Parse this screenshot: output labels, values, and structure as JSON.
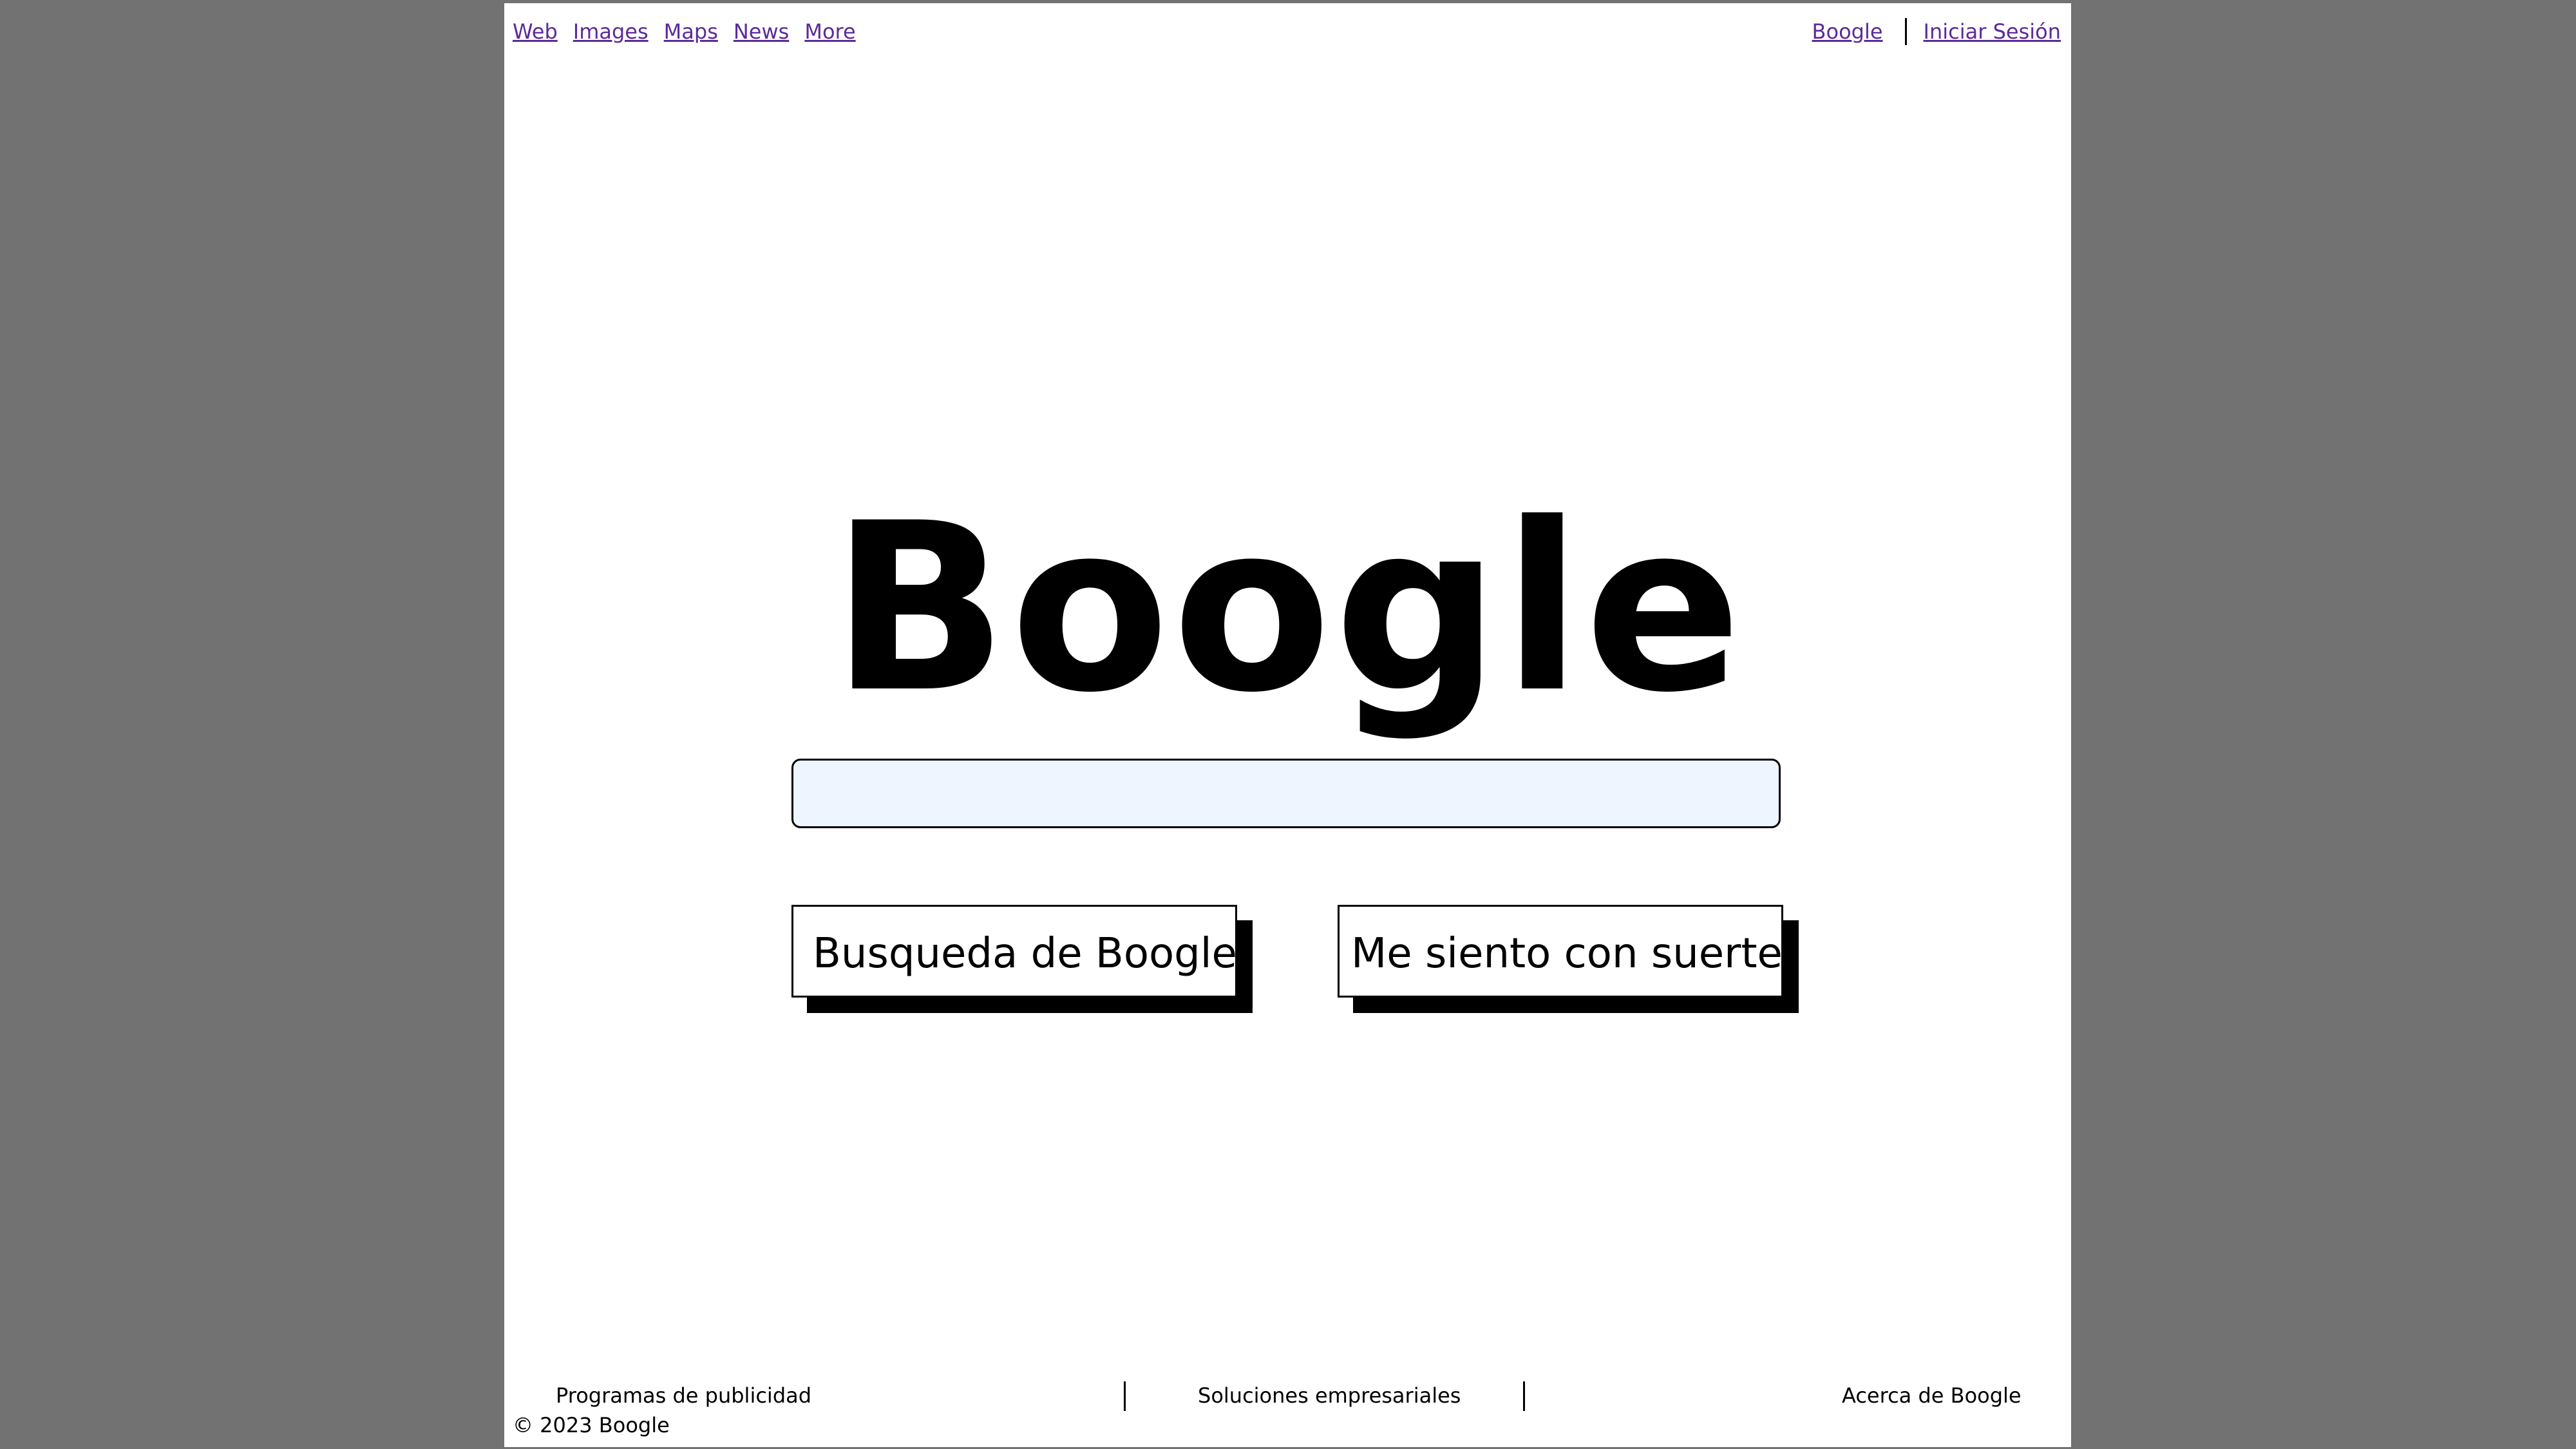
{
  "top_nav": {
    "left_links": [
      "Web",
      "Images",
      "Maps",
      "News",
      "More"
    ],
    "right_links": [
      "Boogle",
      "Iniciar Sesión"
    ]
  },
  "logo": {
    "text": "Boogle"
  },
  "search": {
    "value": "",
    "placeholder": ""
  },
  "buttons": {
    "search_label": "Busqueda de Boogle",
    "lucky_label": "Me siento con suerte"
  },
  "footer": {
    "links": [
      "Programas de publicidad",
      "Soluciones empresariales",
      "Acerca de Boogle"
    ],
    "copyright": "© 2023 Boogle"
  },
  "colors": {
    "background": "#727272",
    "page": "#ffffff",
    "link": "#5b2b99",
    "search_fill": "#eef5ff",
    "text": "#000000"
  }
}
